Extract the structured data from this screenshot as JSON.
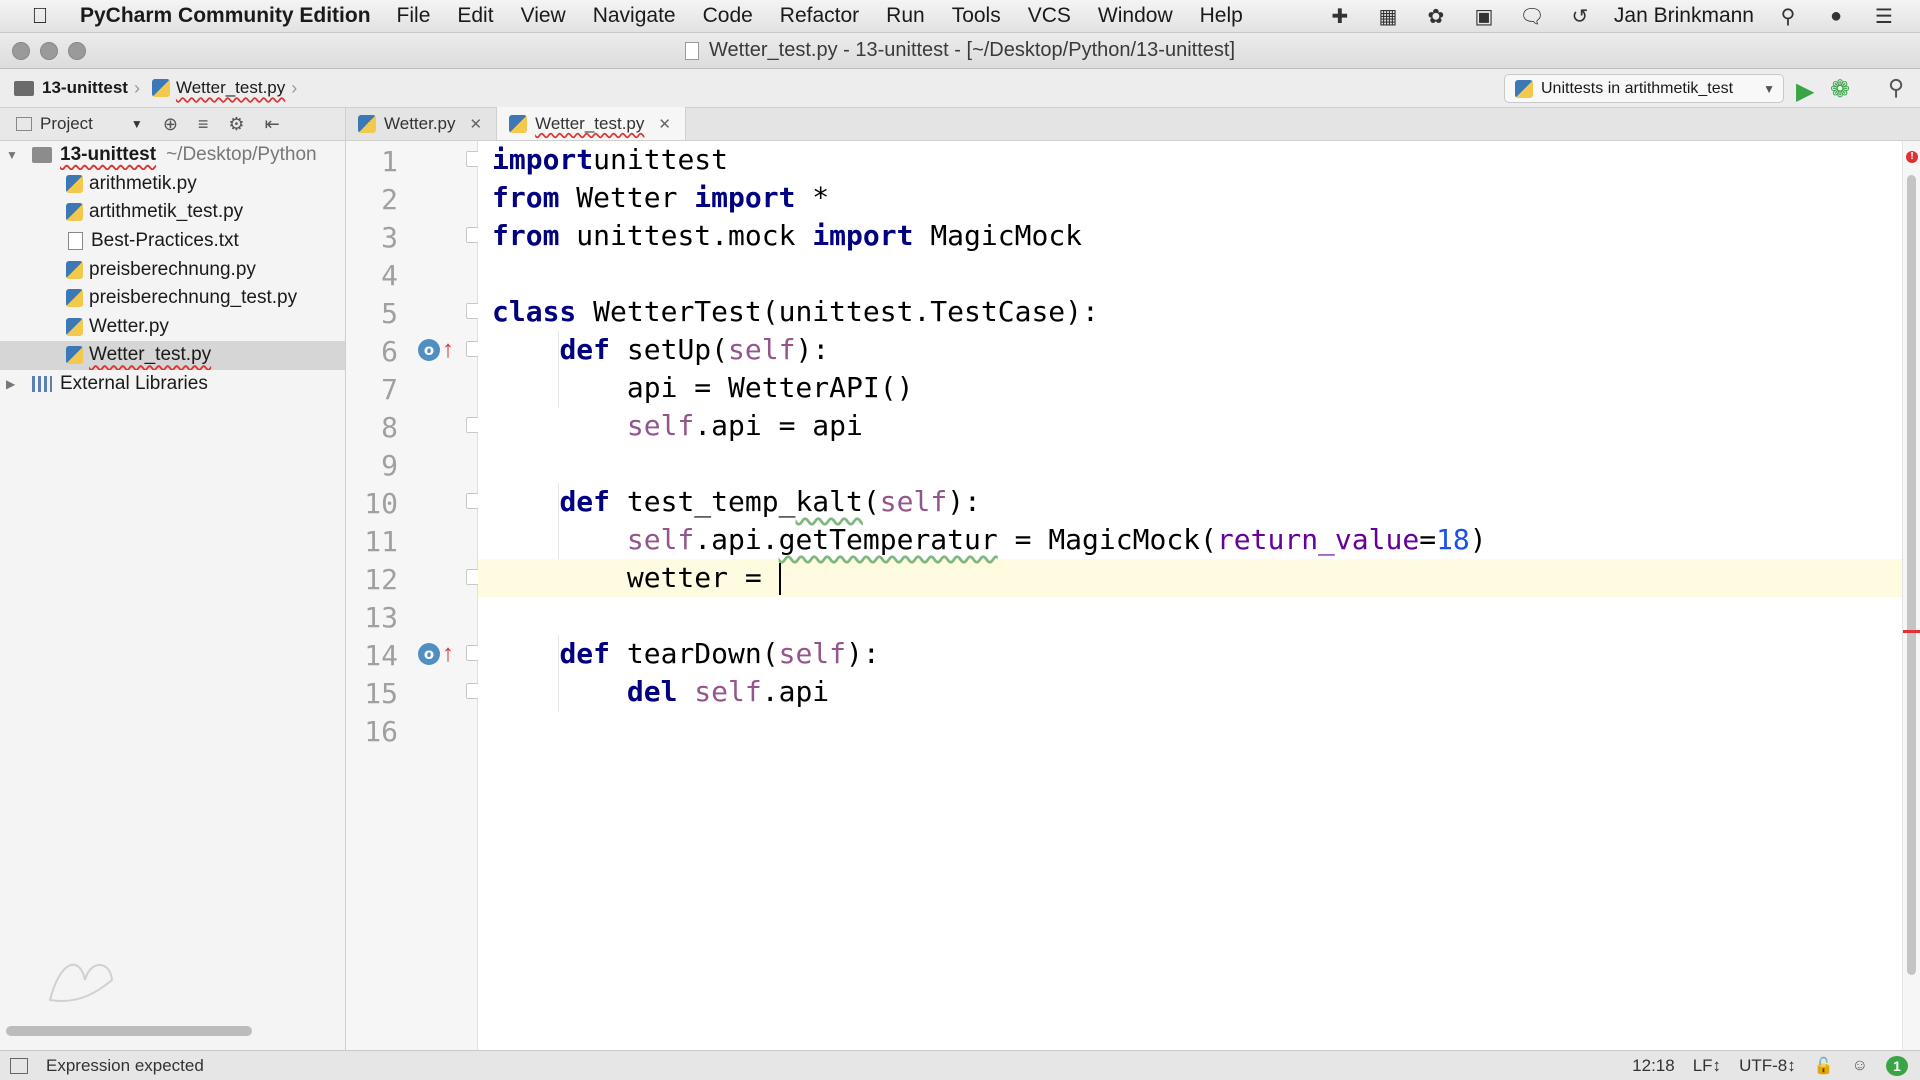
{
  "menubar": {
    "app_name": "PyCharm Community Edition",
    "items": [
      "File",
      "Edit",
      "View",
      "Navigate",
      "Code",
      "Refactor",
      "Run",
      "Tools",
      "VCS",
      "Window",
      "Help"
    ],
    "user": "Jan Brinkmann"
  },
  "window": {
    "title": "Wetter_test.py - 13-unittest - [~/Desktop/Python/13-unittest]"
  },
  "navbar": {
    "project": "13-unittest",
    "file": "Wetter_test.py",
    "run_config": "Unittests in artithmetik_test"
  },
  "project_panel": {
    "label": "Project",
    "root": {
      "name": "13-unittest",
      "path": "~/Desktop/Python"
    },
    "files": [
      {
        "name": "arithmetik.py",
        "type": "py"
      },
      {
        "name": "artithmetik_test.py",
        "type": "py"
      },
      {
        "name": "Best-Practices.txt",
        "type": "txt"
      },
      {
        "name": "preisberechnung.py",
        "type": "py"
      },
      {
        "name": "preisberechnung_test.py",
        "type": "py"
      },
      {
        "name": "Wetter.py",
        "type": "py"
      },
      {
        "name": "Wetter_test.py",
        "type": "py",
        "selected": true
      }
    ],
    "external": "External Libraries"
  },
  "tabs": [
    {
      "label": "Wetter.py",
      "active": false
    },
    {
      "label": "Wetter_test.py",
      "active": true
    }
  ],
  "editor": {
    "line_numbers": [
      "1",
      "2",
      "3",
      "4",
      "5",
      "6",
      "7",
      "8",
      "9",
      "10",
      "11",
      "12",
      "13",
      "14",
      "15",
      "16"
    ],
    "lines": [
      [
        [
          "kw",
          "import"
        ],
        [
          "",
          "unittest"
        ]
      ],
      [
        [
          "kw",
          "from"
        ],
        [
          "",
          " Wetter "
        ],
        [
          "kw",
          "import"
        ],
        [
          "",
          " *"
        ]
      ],
      [
        [
          "kw",
          "from"
        ],
        [
          "",
          " unittest.mock "
        ],
        [
          "kw",
          "import"
        ],
        [
          "",
          " MagicMock"
        ]
      ],
      [],
      [
        [
          "kw",
          "class"
        ],
        [
          "",
          " WetterTest(unittest.TestCase):"
        ]
      ],
      [
        [
          "",
          "    "
        ],
        [
          "kw",
          "def"
        ],
        [
          "",
          " setUp("
        ],
        [
          "self",
          "self"
        ],
        [
          "",
          "):"
        ]
      ],
      [
        [
          "",
          "        api = WetterAPI()"
        ]
      ],
      [
        [
          "",
          "        "
        ],
        [
          "self",
          "self"
        ],
        [
          "",
          ".api = api"
        ]
      ],
      [],
      [
        [
          "",
          "    "
        ],
        [
          "kw",
          "def"
        ],
        [
          "",
          " test_temp_"
        ],
        [
          "warn",
          "kalt"
        ],
        [
          "",
          "("
        ],
        [
          "self",
          "self"
        ],
        [
          "",
          "):"
        ]
      ],
      [
        [
          "",
          "        "
        ],
        [
          "self",
          "self"
        ],
        [
          "",
          ".api."
        ],
        [
          "warn",
          "getTemperatur"
        ],
        [
          "",
          " = MagicMock("
        ],
        [
          "param",
          "return_value"
        ],
        [
          "",
          "="
        ],
        [
          "num",
          "18"
        ],
        [
          "",
          ")"
        ]
      ],
      [
        [
          "",
          "        wetter = "
        ],
        [
          "caret",
          ""
        ]
      ],
      [],
      [
        [
          "",
          "    "
        ],
        [
          "kw",
          "def"
        ],
        [
          "",
          " tearDown("
        ],
        [
          "self",
          "self"
        ],
        [
          "",
          "):"
        ]
      ],
      [
        [
          "",
          "        "
        ],
        [
          "kw",
          "del"
        ],
        [
          "",
          " "
        ],
        [
          "self",
          "self"
        ],
        [
          "",
          ".api"
        ]
      ],
      []
    ],
    "current_line": 12
  },
  "statusbar": {
    "message": "Expression expected",
    "position": "12:18",
    "line_sep": "LF↕",
    "encoding": "UTF-8↕",
    "events": "1"
  }
}
